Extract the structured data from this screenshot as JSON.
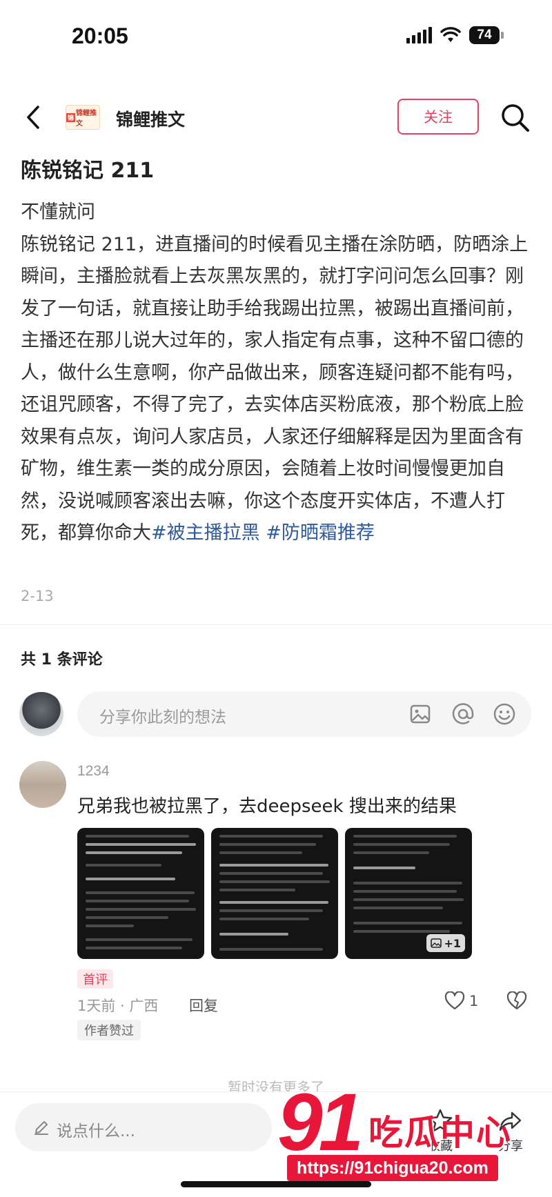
{
  "status_bar": {
    "time": "20:05",
    "battery": "74"
  },
  "nav": {
    "account_name": "锦鲤推文",
    "logo_text": "锦鲤推文",
    "logo_badge": "锦",
    "follow_label": "关注"
  },
  "post": {
    "title": "陈锐铭记 211",
    "intro": "不懂就问",
    "body": "陈锐铭记 211，进直播间的时候看见主播在涂防晒，防晒涂上瞬间，主播脸就看上去灰黑灰黑的，就打字问问怎么回事？刚发了一句话，就直接让助手给我踢出拉黑，被踢出直播间前，主播还在那儿说大过年的，家人指定有点事，这种不留口德的人，做什么生意啊，你产品做出来，顾客连疑问都不能有吗，还诅咒顾客，不得了完了，去实体店买粉底液，那个粉底上脸效果有点灰，询问人家店员，人家还仔细解释是因为里面含有矿物，维生素一类的成分原因，会随着上妆时间慢慢更加自然，没说喊顾客滚出去嘛，你这个态度开实体店，不遭人打死，都算你命大",
    "hashtags": [
      "#被主播拉黑",
      "#防晒霜推荐"
    ],
    "date": "2-13"
  },
  "comments_section": {
    "count_label": "共 1 条评论",
    "input_placeholder": "分享你此刻的想法"
  },
  "comment": {
    "username": "1234",
    "text": "兄弟我也被拉黑了，去deepseek 搜出来的结果",
    "more_images_label": "+1",
    "first_tag": "首评",
    "meta": "1天前 · 广西",
    "reply_label": "回复",
    "like_count": "1",
    "author_liked": "作者赞过"
  },
  "end_hint": "暂时没有更多了",
  "bottom_bar": {
    "input_placeholder": "说点什么...",
    "collect_label": "收藏",
    "share_label": "分享"
  },
  "watermark": {
    "number": "91",
    "brand": "吃瓜中心",
    "url": "https://91chigua20.com"
  }
}
